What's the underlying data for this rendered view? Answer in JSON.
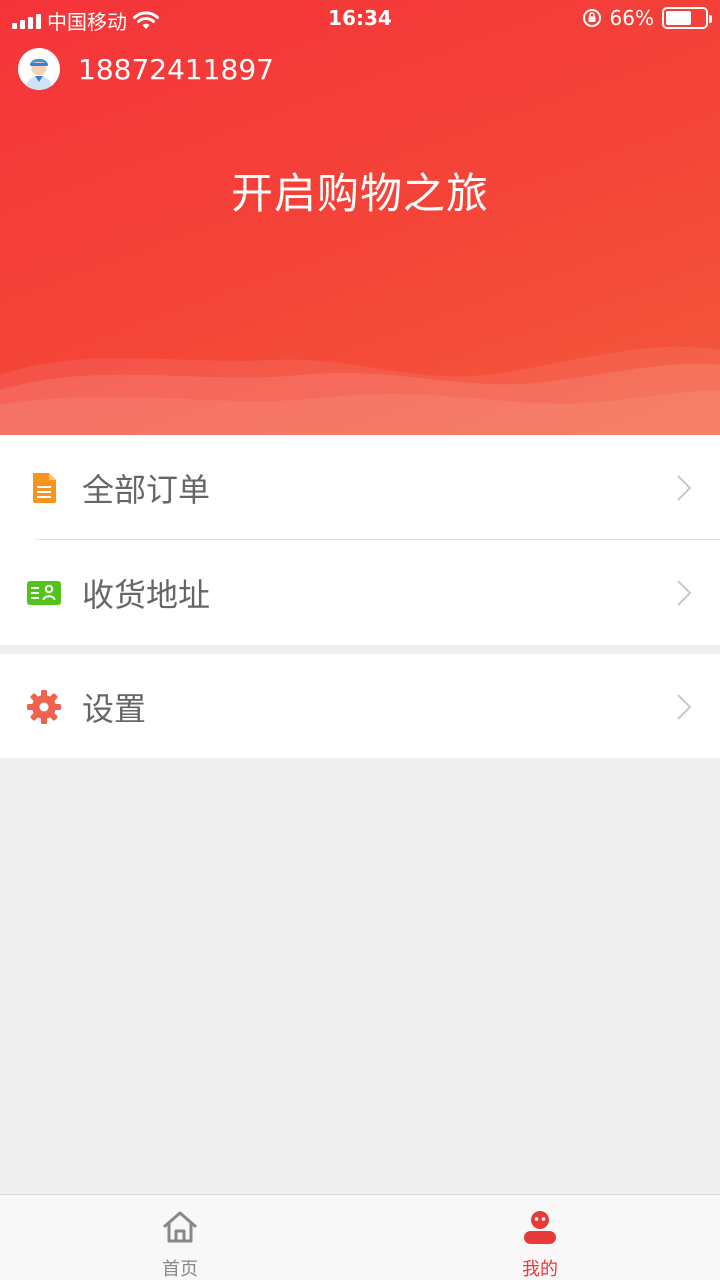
{
  "status_bar": {
    "carrier": "中国移动",
    "time": "16:34",
    "battery": "66%",
    "battery_level": 0.66
  },
  "user": {
    "phone": "18872411897"
  },
  "hero": {
    "slogan": "开启购物之旅"
  },
  "menu": {
    "orders_label": "全部订单",
    "address_label": "收货地址",
    "settings_label": "设置"
  },
  "colors": {
    "brand_red": "#f4393a",
    "orders_icon": "#f7941d",
    "address_icon": "#52c41a",
    "settings_icon": "#f0624d"
  },
  "tabbar": {
    "home_label": "首页",
    "mine_label": "我的",
    "active": "mine"
  }
}
